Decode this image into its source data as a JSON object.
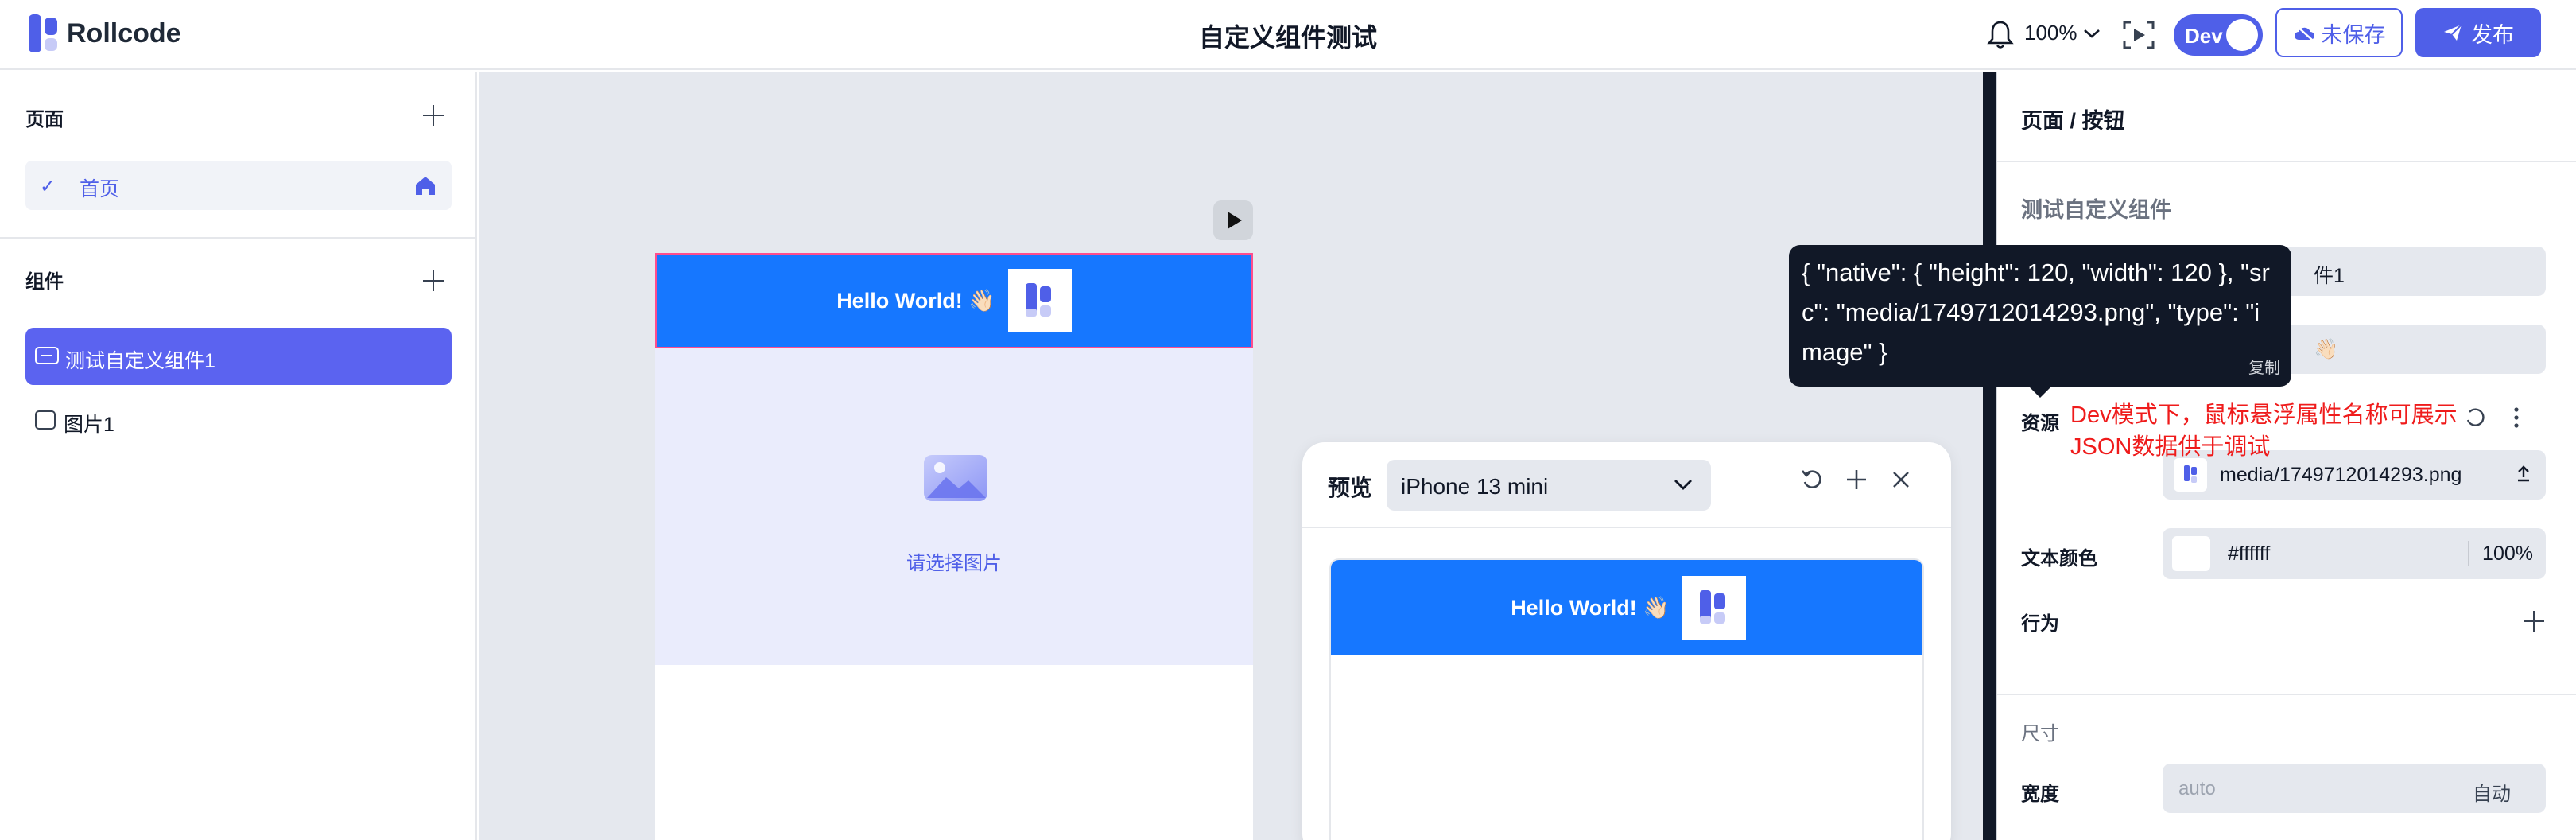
{
  "app": {
    "name": "Rollcode",
    "title": "自定义组件测试"
  },
  "header": {
    "zoom": "100%",
    "dev_label": "Dev",
    "unsaved_label": "未保存",
    "publish_label": "发布",
    "dev_enabled": true
  },
  "sidebar": {
    "pages_title": "页面",
    "pages": [
      {
        "label": "首页",
        "selected": true,
        "home": true
      }
    ],
    "components_title": "组件",
    "components": [
      {
        "label": "测试自定义组件1",
        "selected": true
      },
      {
        "label": "图片1",
        "selected": false
      }
    ]
  },
  "canvas": {
    "banner_text": "Hello World! 👋🏻",
    "image_placeholder": "请选择图片"
  },
  "preview": {
    "label": "预览",
    "device": "iPhone 13 mini",
    "banner_text": "Hello World! 👋🏻"
  },
  "props": {
    "breadcrumb": "页面 / 按钮",
    "component_name": "测试自定义组件",
    "field1_value": "件1",
    "field2_value": "👋🏻",
    "asset_label": "资源",
    "asset_value": "media/1749712014293.png",
    "text_color_label": "文本颜色",
    "text_color_hex": "#ffffff",
    "text_color_opacity": "100%",
    "behavior_label": "行为",
    "size_title": "尺寸",
    "width_label": "宽度",
    "width_placeholder": "auto",
    "width_auto": "自动"
  },
  "tooltip": {
    "json": "{ \"native\": { \"height\": 120, \"width\": 120 }, \"src\": \"media/1749712014293.png\", \"type\": \"image\" }",
    "copy_label": "复制"
  },
  "annotation": "Dev模式下，鼠标悬浮属性名称可展示JSON数据供于调试",
  "colors": {
    "accent": "#4f5fe8",
    "banner": "#1677ff",
    "annotation": "#ef1b1b"
  }
}
